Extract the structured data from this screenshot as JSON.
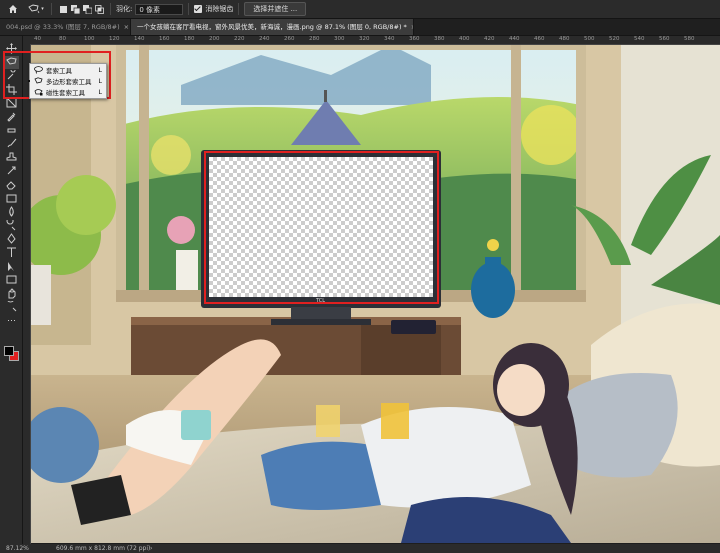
{
  "options_bar": {
    "feather_label": "羽化:",
    "feather_value": "0 像素",
    "antialias_label": "消除锯齿",
    "select_mask_label": "选择并遮住 ..."
  },
  "tabs": [
    {
      "label": "004.psd @ 33.3% (图层 7, RGB/8#)",
      "active": false
    },
    {
      "label": "一个女孩躺在客厅看电视，窗外风景优美，新海诚，漫画.png @ 87.1% (图层 0, RGB/8#) *",
      "active": true
    }
  ],
  "ruler_ticks": [
    "40",
    "80",
    "100",
    "120",
    "140",
    "160",
    "180",
    "200",
    "220",
    "240",
    "260",
    "280",
    "300",
    "320",
    "340",
    "360",
    "380",
    "400",
    "420",
    "440",
    "460",
    "480",
    "500",
    "520",
    "540",
    "560",
    "580"
  ],
  "flyout_menu": [
    {
      "label": "套索工具",
      "shortcut": "L",
      "icon": "lasso-icon",
      "selected": false
    },
    {
      "label": "多边形套索工具",
      "shortcut": "L",
      "icon": "polygonal-lasso-icon",
      "selected": true
    },
    {
      "label": "磁性套索工具",
      "shortcut": "L",
      "icon": "magnetic-lasso-icon",
      "selected": false
    }
  ],
  "tv_brand": "TCL",
  "status": {
    "zoom": "87.12%",
    "doc_size": "609.6 mm x 812.8 mm (72 ppi)"
  },
  "colors": {
    "highlight": "#e02020",
    "foreground": "#000000",
    "background": "#ffffff"
  }
}
